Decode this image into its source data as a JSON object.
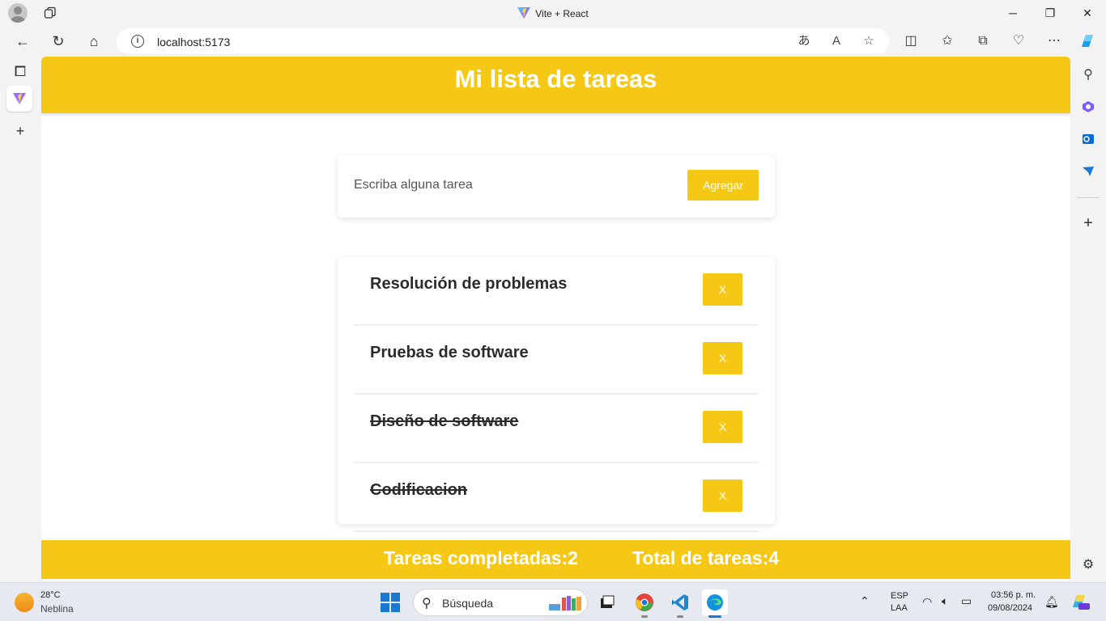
{
  "window": {
    "title": "Vite + React",
    "minimize_label": "─",
    "restore_label": "❐",
    "close_label": "✕"
  },
  "browser": {
    "url": "localhost:5173"
  },
  "app": {
    "title": "Mi lista de tareas",
    "input_placeholder": "Escriba alguna tarea",
    "input_value": "",
    "add_button": "Agregar",
    "delete_label": "X",
    "tasks": [
      {
        "name": "Resolución de problemas",
        "completed": false
      },
      {
        "name": "Pruebas de software",
        "completed": false
      },
      {
        "name": "Diseño de software",
        "completed": true
      },
      {
        "name": "Codificacion",
        "completed": true
      }
    ],
    "footer": {
      "completed": "Tareas completadas:2",
      "total": "Total de tareas:4"
    },
    "accent_color": "#f6c816"
  },
  "taskbar": {
    "weather_temp": "28°C",
    "weather_condition": "Neblina",
    "search_label": "Búsqueda",
    "lang_top": "ESP",
    "lang_bottom": "LAA",
    "time": "03:56 p. m.",
    "date": "09/08/2024"
  }
}
